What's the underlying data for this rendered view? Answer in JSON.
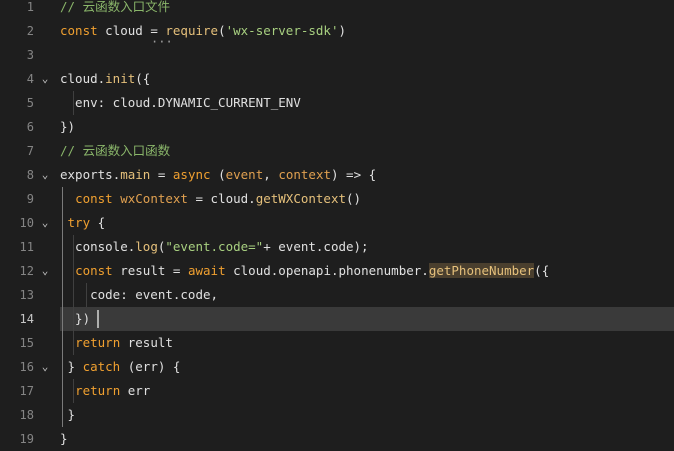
{
  "editor": {
    "active_line": 14,
    "lines": [
      {
        "num": "1",
        "fold": "",
        "segments": [
          {
            "t": "// 云函数入口文件",
            "c": "cm"
          }
        ]
      },
      {
        "num": "2",
        "fold": "",
        "segments": [
          {
            "t": "const",
            "c": "k"
          },
          {
            "t": " cloud = ",
            "c": "w"
          },
          {
            "t": "require",
            "c": "y"
          },
          {
            "t": "(",
            "c": "w"
          },
          {
            "t": "'wx-server-sdk'",
            "c": "s"
          },
          {
            "t": ")",
            "c": "w"
          }
        ]
      },
      {
        "num": "3",
        "fold": "",
        "segments": []
      },
      {
        "num": "4",
        "fold": "v",
        "segments": [
          {
            "t": "cloud.",
            "c": "w"
          },
          {
            "t": "init",
            "c": "y"
          },
          {
            "t": "({",
            "c": "w"
          }
        ]
      },
      {
        "num": "5",
        "fold": "",
        "segments": [
          {
            "t": "  env: cloud.DYNAMIC_CURRENT_ENV",
            "c": "w"
          }
        ]
      },
      {
        "num": "6",
        "fold": "",
        "segments": [
          {
            "t": "})",
            "c": "w"
          }
        ]
      },
      {
        "num": "7",
        "fold": "",
        "segments": [
          {
            "t": "// 云函数入口函数",
            "c": "cm"
          }
        ]
      },
      {
        "num": "8",
        "fold": "v",
        "segments": [
          {
            "t": "exports",
            "c": "w"
          },
          {
            "t": ".",
            "c": "w"
          },
          {
            "t": "main",
            "c": "y"
          },
          {
            "t": " = ",
            "c": "w"
          },
          {
            "t": "async",
            "c": "k"
          },
          {
            "t": " (",
            "c": "w"
          },
          {
            "t": "event",
            "c": "p"
          },
          {
            "t": ", ",
            "c": "w"
          },
          {
            "t": "context",
            "c": "p"
          },
          {
            "t": ") => {",
            "c": "w"
          }
        ]
      },
      {
        "num": "9",
        "fold": "",
        "segments": [
          {
            "t": "  ",
            "c": "w"
          },
          {
            "t": "const",
            "c": "k"
          },
          {
            "t": " wxContext",
            "c": "p"
          },
          {
            "t": " = cloud.",
            "c": "w"
          },
          {
            "t": "getWXContext",
            "c": "y"
          },
          {
            "t": "()",
            "c": "w"
          }
        ]
      },
      {
        "num": "10",
        "fold": "v",
        "segments": [
          {
            "t": " ",
            "c": "w"
          },
          {
            "t": "try",
            "c": "k"
          },
          {
            "t": " {",
            "c": "w"
          }
        ]
      },
      {
        "num": "11",
        "fold": "",
        "segments": [
          {
            "t": "  console.",
            "c": "w"
          },
          {
            "t": "log",
            "c": "y"
          },
          {
            "t": "(",
            "c": "w"
          },
          {
            "t": "\"event.code=\"",
            "c": "s"
          },
          {
            "t": "+ event.code);",
            "c": "w"
          }
        ]
      },
      {
        "num": "12",
        "fold": "v",
        "segments": [
          {
            "t": "  ",
            "c": "w"
          },
          {
            "t": "const",
            "c": "k"
          },
          {
            "t": " result = ",
            "c": "w"
          },
          {
            "t": "await",
            "c": "k"
          },
          {
            "t": " cloud.openapi.phonenumber.",
            "c": "w"
          },
          {
            "t": "getPhoneNumber",
            "c": "y",
            "hl": true
          },
          {
            "t": "({",
            "c": "w"
          }
        ]
      },
      {
        "num": "13",
        "fold": "",
        "segments": [
          {
            "t": "    code: event.code,",
            "c": "w"
          }
        ]
      },
      {
        "num": "14",
        "fold": "",
        "segments": [
          {
            "t": "  })",
            "c": "w"
          }
        ]
      },
      {
        "num": "15",
        "fold": "",
        "segments": [
          {
            "t": "  ",
            "c": "w"
          },
          {
            "t": "return",
            "c": "k"
          },
          {
            "t": " result",
            "c": "w"
          }
        ]
      },
      {
        "num": "16",
        "fold": "v",
        "segments": [
          {
            "t": " } ",
            "c": "w"
          },
          {
            "t": "catch",
            "c": "k"
          },
          {
            "t": " (err) {",
            "c": "w"
          }
        ]
      },
      {
        "num": "17",
        "fold": "",
        "segments": [
          {
            "t": "  ",
            "c": "w"
          },
          {
            "t": "return",
            "c": "k"
          },
          {
            "t": " err",
            "c": "w"
          }
        ]
      },
      {
        "num": "18",
        "fold": "",
        "segments": [
          {
            "t": " }",
            "c": "w"
          }
        ]
      },
      {
        "num": "19",
        "fold": "",
        "segments": [
          {
            "t": "}",
            "c": "w"
          }
        ]
      }
    ]
  }
}
